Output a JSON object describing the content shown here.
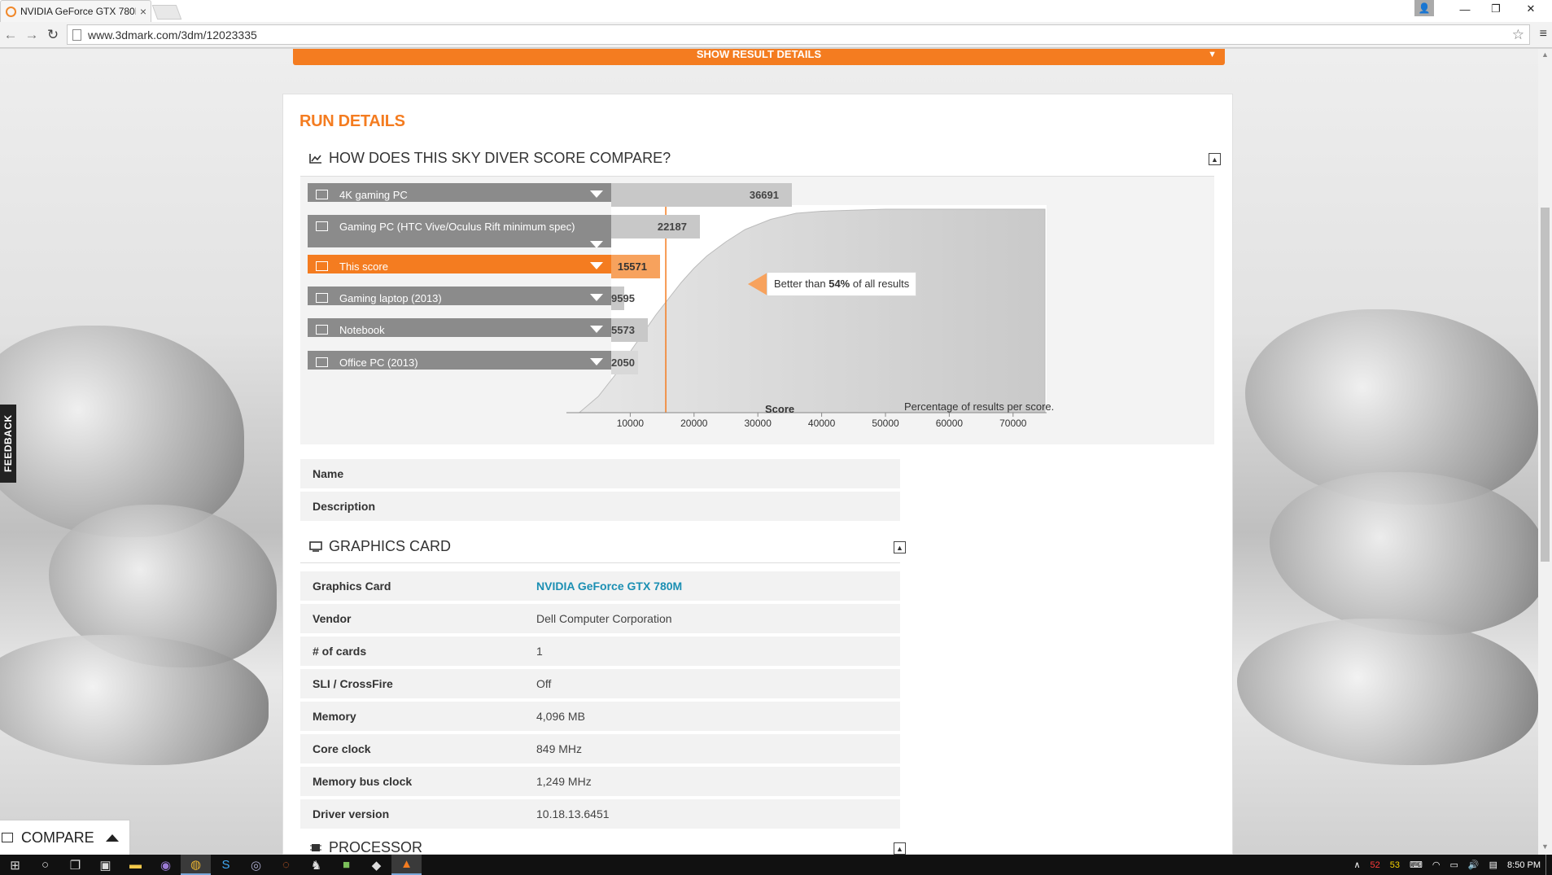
{
  "browser": {
    "tab_title": "NVIDIA GeForce GTX 780M",
    "tab_close": "×",
    "url": "www.3dmark.com/3dm/12023335",
    "back": "←",
    "forward": "→",
    "reload": "↻",
    "star": "☆",
    "menu": "≡",
    "minimize": "—",
    "restore": "❐",
    "close": "✕"
  },
  "page": {
    "show_result_details": "SHOW RESULT DETAILS",
    "run_details_title": "RUN DETAILS",
    "compare_section_title": "HOW DOES THIS SKY DIVER SCORE COMPARE?",
    "rows": [
      {
        "label": "4K gaming PC",
        "score": "36691",
        "highlight": false
      },
      {
        "label": "Gaming PC (HTC Vive/Oculus Rift minimum spec)",
        "score": "22187",
        "highlight": false
      },
      {
        "label": "This score",
        "score": "15571",
        "highlight": true
      },
      {
        "label": "Gaming laptop (2013)",
        "score": "9595",
        "highlight": false
      },
      {
        "label": "Notebook",
        "score": "5573",
        "highlight": false
      },
      {
        "label": "Office PC (2013)",
        "score": "2050",
        "highlight": false
      }
    ],
    "callout": {
      "prefix": "Better than ",
      "percent": "54%",
      "suffix": " of all results"
    },
    "name_label": "Name",
    "description_label": "Description",
    "graphics_card_title": "GRAPHICS CARD",
    "graphics_card": [
      {
        "key": "Graphics Card",
        "value": "NVIDIA GeForce GTX 780M",
        "link": true
      },
      {
        "key": "Vendor",
        "value": "Dell Computer Corporation",
        "link": false
      },
      {
        "key": "# of cards",
        "value": "1",
        "link": false
      },
      {
        "key": "SLI / CrossFire",
        "value": "Off",
        "link": false
      },
      {
        "key": "Memory",
        "value": "4,096 MB",
        "link": false
      },
      {
        "key": "Core clock",
        "value": "849 MHz",
        "link": false
      },
      {
        "key": "Memory bus clock",
        "value": "1,249 MHz",
        "link": false
      },
      {
        "key": "Driver version",
        "value": "10.18.13.6451",
        "link": false
      }
    ],
    "processor_title": "PROCESSOR",
    "feedback": "FEEDBACK",
    "compare_button": "COMPARE"
  },
  "chart_data": {
    "type": "area",
    "xlabel": "Score",
    "ylabel": "Percentage of results per score.",
    "x_ticks": [
      10000,
      20000,
      30000,
      40000,
      50000,
      60000,
      70000
    ],
    "xlim": [
      0,
      75000
    ],
    "marker_score": 15571,
    "percentile": 54,
    "cumulative_curve": {
      "x": [
        2000,
        5000,
        8000,
        10000,
        12000,
        14000,
        16000,
        18000,
        20000,
        22000,
        25000,
        28000,
        32000,
        36000,
        40000,
        50000,
        60000,
        75000
      ],
      "y": [
        0,
        0.08,
        0.2,
        0.3,
        0.39,
        0.48,
        0.56,
        0.64,
        0.71,
        0.77,
        0.84,
        0.9,
        0.95,
        0.98,
        0.99,
        1.0,
        1.0,
        1.0
      ]
    }
  },
  "taskbar": {
    "time": "8:50 PM",
    "tray_values": [
      "52",
      "53"
    ]
  }
}
